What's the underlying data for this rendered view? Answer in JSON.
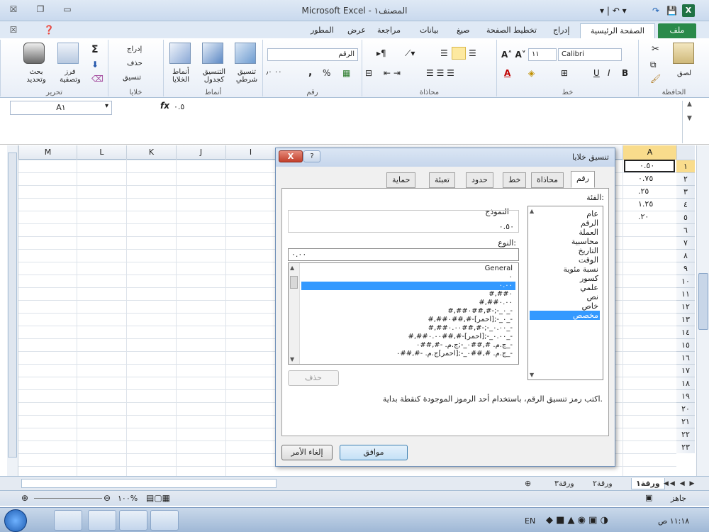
{
  "window": {
    "title": "Microsoft Excel - المصنف١"
  },
  "tabs": [
    "ملف",
    "الصفحة الرئيسية",
    "إدراج",
    "تخطيط الصفحة",
    "صيغ",
    "بيانات",
    "مراجعة",
    "عرض",
    "المطور"
  ],
  "ribbon": {
    "clipboard_label": "الحافظة",
    "paste": "لصق",
    "font_label": "خط",
    "font_name": "Calibri",
    "font_size": "١١",
    "bold": "B",
    "italic": "I",
    "underline": "U",
    "align_label": "محاذاة",
    "number_label": "رقم",
    "number_format": "الرقم",
    "percent": "%",
    "comma": ",",
    "inc_dec": "٠٠ ٫٠",
    "styles_label": "أنماط",
    "cond_fmt": "تنسيق شرطي",
    "format_table": "التنسيق كجدول",
    "cell_styles": "أنماط الخلايا",
    "cells_label": "خلايا",
    "insert": "إدراج",
    "delete": "حذف",
    "format": "تنسيق",
    "edit_label": "تحرير",
    "sum": "Σ",
    "sort_filter": "فرز وتصفية",
    "find": "بحث وتحديد"
  },
  "namebox": "A١",
  "formula_fx": "fx",
  "formula_value": "٠.٥",
  "columns": [
    "M",
    "L",
    "K",
    "J",
    "I",
    "A"
  ],
  "rows": [
    "١",
    "٢",
    "٣",
    "٤",
    "٥",
    "٦",
    "٧",
    "٨",
    "٩",
    "١٠",
    "١١",
    "١٢",
    "١٣",
    "١٤",
    "١٥",
    "١٦",
    "١٧",
    "١٨",
    "١٩",
    "٢٠",
    "٢١",
    "٢٢",
    "٢٣"
  ],
  "cells": [
    "٠.٥٠",
    "٠.٧٥",
    ".٢٥",
    "١.٢٥",
    ".٢٠"
  ],
  "sheets": [
    "ورقة١",
    "ورقة٢",
    "ورقة٣"
  ],
  "status": {
    "ready": "جاهز",
    "zoom": "١٠٠%"
  },
  "dialog": {
    "title": "تنسيق خلايا",
    "close": "X",
    "help": "?",
    "tabs": [
      "رقم",
      "محاذاة",
      "خط",
      "حدود",
      "تعبئة",
      "حماية"
    ],
    "category_label": "الفئة:",
    "categories": [
      "عام",
      "الرقم",
      "العملة",
      "محاسبية",
      "التاريخ",
      "الوقت",
      "نسبة مئوية",
      "كسور",
      "علمي",
      "نص",
      "خاص",
      "مخصص"
    ],
    "selected_category": "مخصص",
    "sample_label": "النموذج",
    "sample_value": "٠.٥٠",
    "type_label": "النوع:",
    "type_value": "٠.٠٠",
    "types": [
      "General",
      "٠",
      "٠.٠٠",
      "#,##٠",
      "#,##٠.٠٠",
      "#,##٠_-;-#,##٠_-",
      "#,##٠_-;[أحمر]-#,##٠_-",
      "#,##٠.٠٠_-;-#,##٠.٠٠_-",
      "#,##٠.٠٠_-;[أحمر]-#,##٠.٠٠_-",
      "ج.م.‏ #,##٠_-;ج.م.‏ -#,##٠_-",
      "ج.م.‏ #,##٠_-;[أحمر]ج.م.‏ -#,##٠_-"
    ],
    "delete_button": "حذف",
    "hint": "اكتب رمز تنسيق الرقم، باستخدام أحد الرموز الموجودة كنقطة بداية.",
    "ok": "موافق",
    "cancel": "إلغاء الأمر"
  },
  "taskbar": {
    "lang": "EN",
    "clock": "١١:١٨ ص"
  }
}
